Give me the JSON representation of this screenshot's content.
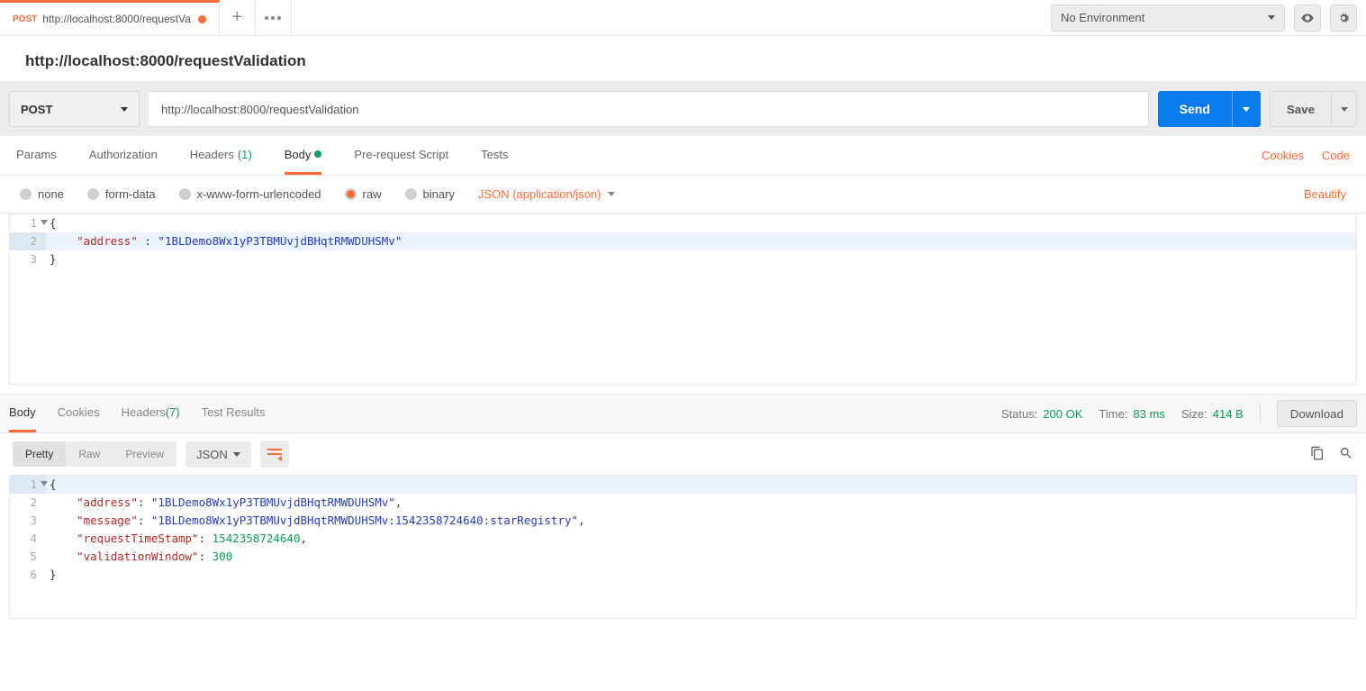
{
  "topbar": {
    "tab_method": "POST",
    "tab_title": "http://localhost:8000/requestVa",
    "env_label": "No Environment"
  },
  "title": "http://localhost:8000/requestValidation",
  "request": {
    "method": "POST",
    "url": "http://localhost:8000/requestValidation",
    "send": "Send",
    "save": "Save"
  },
  "tabs": {
    "params": "Params",
    "auth": "Authorization",
    "headers": "Headers",
    "headers_count": "(1)",
    "body": "Body",
    "prereq": "Pre-request Script",
    "tests": "Tests",
    "cookies": "Cookies",
    "code": "Code"
  },
  "body_opts": {
    "none": "none",
    "form": "form-data",
    "url": "x-www-form-urlencoded",
    "raw": "raw",
    "binary": "binary",
    "ctype": "JSON (application/json)",
    "beautify": "Beautify"
  },
  "req_body": {
    "l1": "{",
    "l2_key": "\"address\"",
    "l2_sep": " : ",
    "l2_val": "\"1BLDemo8Wx1yP3TBMUvjdBHqtRMWDUHSMv\"",
    "l3": "}"
  },
  "resp_tabs": {
    "body": "Body",
    "cookies": "Cookies",
    "headers": "Headers",
    "headers_count": "(7)",
    "test": "Test Results"
  },
  "status": {
    "status_label": "Status:",
    "status_val": "200 OK",
    "time_label": "Time:",
    "time_val": "83 ms",
    "size_label": "Size:",
    "size_val": "414 B",
    "download": "Download"
  },
  "view": {
    "pretty": "Pretty",
    "raw": "Raw",
    "preview": "Preview",
    "json": "JSON"
  },
  "resp_body": {
    "address_k": "\"address\"",
    "address_v": "\"1BLDemo8Wx1yP3TBMUvjdBHqtRMWDUHSMv\"",
    "message_k": "\"message\"",
    "message_v": "\"1BLDemo8Wx1yP3TBMUvjdBHqtRMWDUHSMv:1542358724640:starRegistry\"",
    "ts_k": "\"requestTimeStamp\"",
    "ts_v": "1542358724640",
    "win_k": "\"validationWindow\"",
    "win_v": "300"
  }
}
